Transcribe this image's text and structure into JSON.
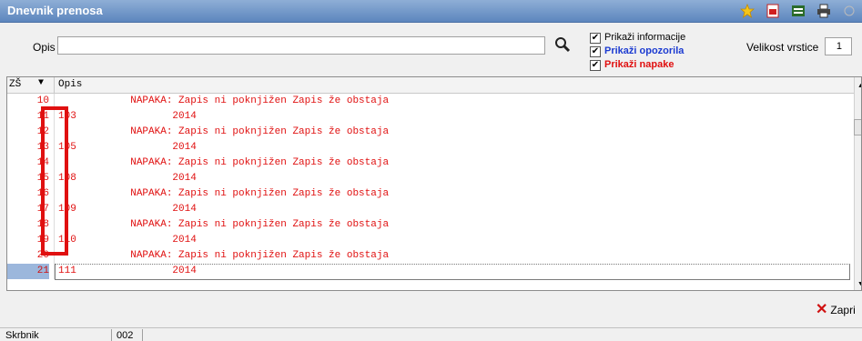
{
  "window": {
    "title": "Dnevnik prenosa",
    "toolbar_icons": [
      "star-icon",
      "pdf-export-icon",
      "excel-export-icon",
      "print-icon",
      "help-icon"
    ]
  },
  "filter": {
    "opis_label": "Opis",
    "opis_value": "",
    "show_info": {
      "label": "Prikaži informacije",
      "checked": true
    },
    "show_warnings": {
      "label": "Prikaži opozorila",
      "checked": true
    },
    "show_errors": {
      "label": "Prikaži napake",
      "checked": true
    },
    "row_size_label": "Velikost vrstice",
    "row_size_value": "1"
  },
  "grid": {
    "col_zs": "ZŠ",
    "col_opis": "Opis",
    "rows": [
      {
        "num": "10",
        "text": "            NAPAKA: Zapis ni poknjižen Zapis že obstaja"
      },
      {
        "num": "11",
        "text": "103                2014"
      },
      {
        "num": "12",
        "text": "            NAPAKA: Zapis ni poknjižen Zapis že obstaja"
      },
      {
        "num": "13",
        "text": "105                2014"
      },
      {
        "num": "14",
        "text": "            NAPAKA: Zapis ni poknjižen Zapis že obstaja"
      },
      {
        "num": "15",
        "text": "108                2014"
      },
      {
        "num": "16",
        "text": "            NAPAKA: Zapis ni poknjižen Zapis že obstaja"
      },
      {
        "num": "17",
        "text": "109                2014"
      },
      {
        "num": "18",
        "text": "            NAPAKA: Zapis ni poknjižen Zapis že obstaja"
      },
      {
        "num": "19",
        "text": "110                2014"
      },
      {
        "num": "20",
        "text": "            NAPAKA: Zapis ni poknjižen Zapis že obstaja"
      },
      {
        "num": "21",
        "text": "111                2014"
      }
    ],
    "selected_row": 11
  },
  "footer": {
    "close_label": "Zapri"
  },
  "status": {
    "user": "Skrbnik",
    "code": "002"
  },
  "colors": {
    "error_text": "#e01010",
    "warning_text": "#1c3bd1",
    "titlebar": "#6f93c8",
    "selected_rownum": "#9cb7dc"
  }
}
